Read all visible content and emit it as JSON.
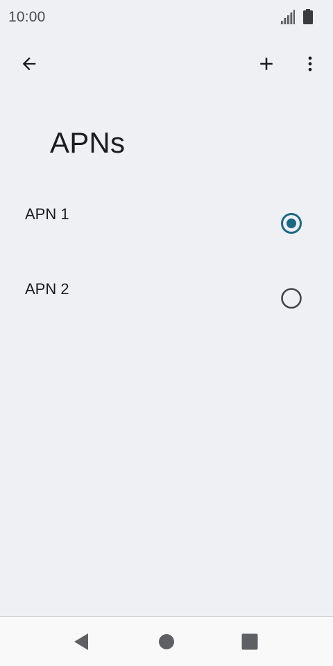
{
  "status_bar": {
    "time": "10:00",
    "icons": [
      "signal-icon",
      "battery-icon"
    ]
  },
  "app_bar": {
    "back_icon": "arrow-back-icon",
    "add_icon": "plus-icon",
    "more_icon": "more-vert-icon"
  },
  "page": {
    "title": "APNs"
  },
  "apn_list": {
    "items": [
      {
        "label": "APN 1",
        "selected": true
      },
      {
        "label": "APN 2",
        "selected": false
      }
    ]
  },
  "nav_bar": {
    "icons": [
      "nav-back-icon",
      "nav-home-icon",
      "nav-recents-icon"
    ]
  },
  "colors": {
    "background": "#eff0f3",
    "accent": "#1a6985",
    "text": "#1b1c1f",
    "nav_background": "#f9f9fa"
  }
}
